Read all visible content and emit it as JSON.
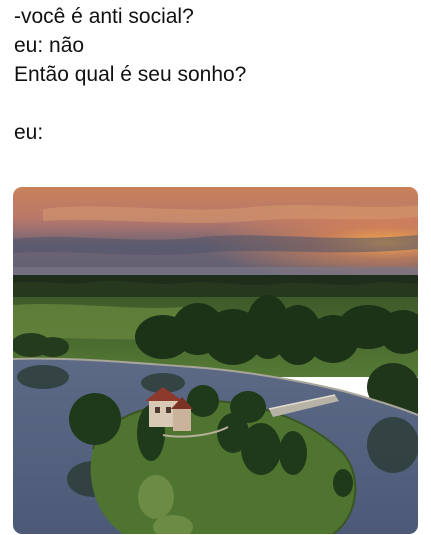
{
  "caption": {
    "line1": "-você é anti social?",
    "line2": "eu: não",
    "line3": "Então qual é seu sonho?",
    "line4": "eu:"
  },
  "photo": {
    "subject": "aerial view of a small island with a house, trees and a footbridge on a calm lake at sunset"
  }
}
